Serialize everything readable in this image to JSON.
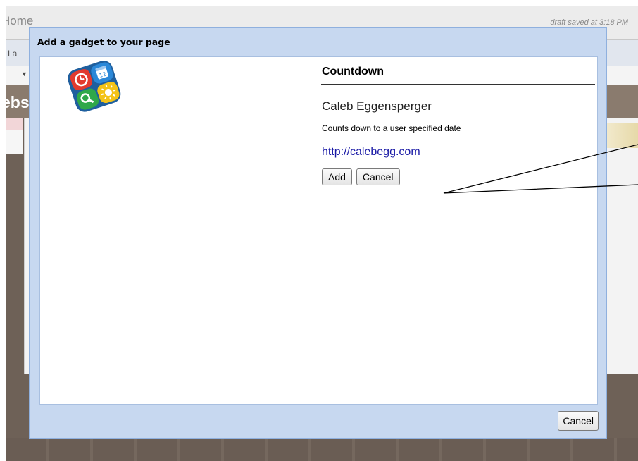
{
  "background": {
    "home_label": "Home",
    "draft_status": "draft saved at 3:18 PM",
    "tab_label": "La",
    "site_title_fragment": "ebs"
  },
  "dialog": {
    "title": "Add a gadget to your page",
    "gadget": {
      "icon": "gadgets-logo-icon",
      "name": "Countdown",
      "author": "Caleb Eggensperger",
      "description": "Counts down to a user specified date",
      "link_text": "http://calebegg.com"
    },
    "add_label": "Add",
    "cancel_label": "Cancel",
    "footer_cancel_label": "Cancel"
  },
  "colors": {
    "dialog_frame": "#c7d8f0",
    "dialog_border": "#8fb0de",
    "link": "#1a1aa6",
    "page_background": "#6e6157"
  }
}
